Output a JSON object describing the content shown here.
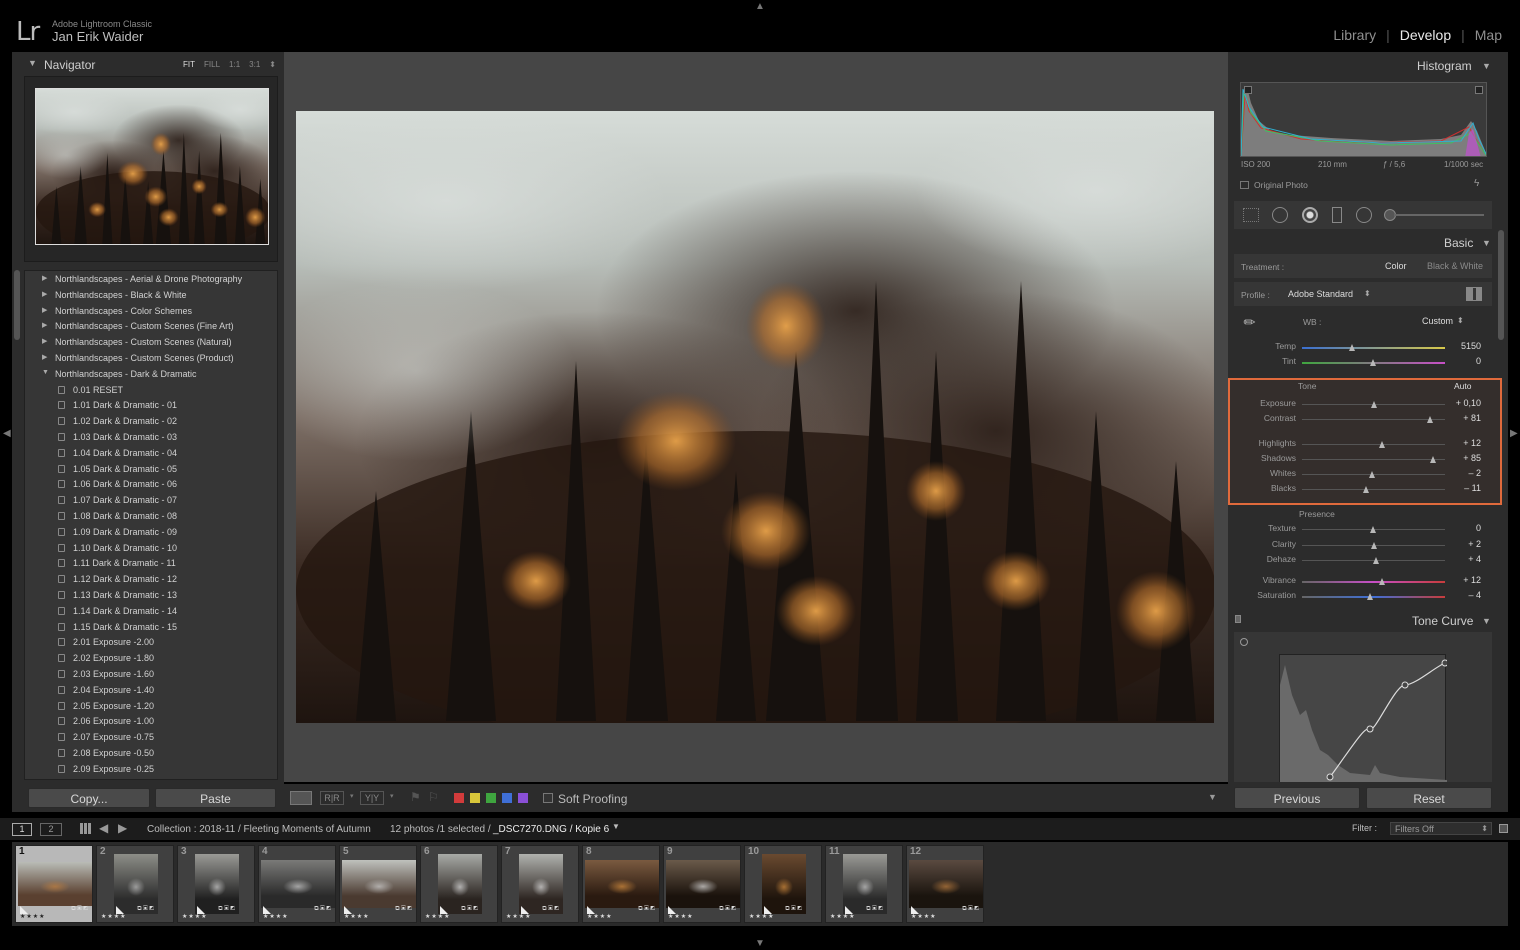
{
  "header": {
    "app_name": "Adobe Lightroom Classic",
    "user_name": "Jan Erik Waider",
    "logo": "Lr",
    "modules": [
      "Library",
      "Develop",
      "Map"
    ],
    "active_module": "Develop"
  },
  "navigator": {
    "title": "Navigator",
    "zoom_options": [
      "FIT",
      "FILL",
      "1:1",
      "3:1"
    ],
    "active_zoom": "FIT"
  },
  "presets": [
    {
      "label": "Northlandscapes - Aerial & Drone Photography",
      "type": "folder",
      "open": false
    },
    {
      "label": "Northlandscapes - Black & White",
      "type": "folder",
      "open": false
    },
    {
      "label": "Northlandscapes - Color Schemes",
      "type": "folder",
      "open": false
    },
    {
      "label": "Northlandscapes - Custom Scenes (Fine Art)",
      "type": "folder",
      "open": false
    },
    {
      "label": "Northlandscapes - Custom Scenes (Natural)",
      "type": "folder",
      "open": false
    },
    {
      "label": "Northlandscapes - Custom Scenes (Product)",
      "type": "folder",
      "open": false
    },
    {
      "label": "Northlandscapes - Dark & Dramatic",
      "type": "folder",
      "open": true
    },
    {
      "label": "0.01 RESET",
      "type": "preset"
    },
    {
      "label": "1.01 Dark & Dramatic - 01",
      "type": "preset"
    },
    {
      "label": "1.02 Dark & Dramatic - 02",
      "type": "preset"
    },
    {
      "label": "1.03 Dark & Dramatic - 03",
      "type": "preset"
    },
    {
      "label": "1.04 Dark & Dramatic - 04",
      "type": "preset"
    },
    {
      "label": "1.05 Dark & Dramatic - 05",
      "type": "preset"
    },
    {
      "label": "1.06 Dark & Dramatic - 06",
      "type": "preset"
    },
    {
      "label": "1.07 Dark & Dramatic - 07",
      "type": "preset"
    },
    {
      "label": "1.08 Dark & Dramatic - 08",
      "type": "preset"
    },
    {
      "label": "1.09 Dark & Dramatic - 09",
      "type": "preset"
    },
    {
      "label": "1.10 Dark & Dramatic - 10",
      "type": "preset"
    },
    {
      "label": "1.11 Dark & Dramatic - 11",
      "type": "preset"
    },
    {
      "label": "1.12 Dark & Dramatic - 12",
      "type": "preset"
    },
    {
      "label": "1.13 Dark & Dramatic - 13",
      "type": "preset"
    },
    {
      "label": "1.14 Dark & Dramatic - 14",
      "type": "preset"
    },
    {
      "label": "1.15 Dark & Dramatic - 15",
      "type": "preset"
    },
    {
      "label": "2.01 Exposure -2.00",
      "type": "preset"
    },
    {
      "label": "2.02 Exposure -1.80",
      "type": "preset"
    },
    {
      "label": "2.03 Exposure -1.60",
      "type": "preset"
    },
    {
      "label": "2.04 Exposure -1.40",
      "type": "preset"
    },
    {
      "label": "2.05 Exposure -1.20",
      "type": "preset"
    },
    {
      "label": "2.06 Exposure -1.00",
      "type": "preset"
    },
    {
      "label": "2.07 Exposure -0.75",
      "type": "preset"
    },
    {
      "label": "2.08 Exposure -0.50",
      "type": "preset"
    },
    {
      "label": "2.09 Exposure -0.25",
      "type": "preset"
    }
  ],
  "left_buttons": {
    "copy": "Copy...",
    "paste": "Paste"
  },
  "toolbar": {
    "soft_proofing": "Soft Proofing",
    "label_colors": [
      "#d23b3b",
      "#d8c63a",
      "#3fa53f",
      "#3f6fd6",
      "#8a4fd6"
    ]
  },
  "histogram": {
    "title": "Histogram",
    "iso": "ISO 200",
    "focal": "210 mm",
    "aperture": "ƒ / 5,6",
    "shutter": "1/1000 sec",
    "original_photo": "Original Photo"
  },
  "basic": {
    "title": "Basic",
    "treatment_label": "Treatment :",
    "treatment_color": "Color",
    "treatment_bw": "Black & White",
    "profile_label": "Profile :",
    "profile_value": "Adobe Standard",
    "wb_label": "WB :",
    "wb_value": "Custom",
    "tone_label": "Tone",
    "auto_label": "Auto",
    "presence_label": "Presence",
    "sliders": [
      {
        "label": "Temp",
        "value": "5150",
        "pos": 0.35,
        "group": "wb"
      },
      {
        "label": "Tint",
        "value": "0",
        "pos": 0.5,
        "group": "wb"
      },
      {
        "label": "Exposure",
        "value": "+ 0,10",
        "pos": 0.51,
        "group": "tone"
      },
      {
        "label": "Contrast",
        "value": "+ 81",
        "pos": 0.9,
        "group": "tone"
      },
      {
        "label": "Highlights",
        "value": "+ 12",
        "pos": 0.56,
        "group": "tone"
      },
      {
        "label": "Shadows",
        "value": "+ 85",
        "pos": 0.92,
        "group": "tone"
      },
      {
        "label": "Whites",
        "value": "– 2",
        "pos": 0.49,
        "group": "tone"
      },
      {
        "label": "Blacks",
        "value": "– 11",
        "pos": 0.45,
        "group": "tone"
      },
      {
        "label": "Texture",
        "value": "0",
        "pos": 0.5,
        "group": "presence"
      },
      {
        "label": "Clarity",
        "value": "+ 2",
        "pos": 0.51,
        "group": "presence"
      },
      {
        "label": "Dehaze",
        "value": "+ 4",
        "pos": 0.52,
        "group": "presence"
      },
      {
        "label": "Vibrance",
        "value": "+ 12",
        "pos": 0.56,
        "group": "presence"
      },
      {
        "label": "Saturation",
        "value": "– 4",
        "pos": 0.48,
        "group": "presence"
      }
    ]
  },
  "tone_curve": {
    "title": "Tone Curve"
  },
  "right_buttons": {
    "previous": "Previous",
    "reset": "Reset"
  },
  "filmstrip": {
    "page1": "1",
    "page2": "2",
    "breadcrumb": "Collection : 2018-11 / Fleeting Moments of Autumn",
    "count": "12 photos /1 selected /",
    "filename": "_DSC7270.DNG / Kopie 6",
    "filter_label": "Filter :",
    "filter_value": "Filters Off",
    "thumbs": [
      "1",
      "2",
      "3",
      "4",
      "5",
      "6",
      "7",
      "8",
      "9",
      "10",
      "11",
      "12"
    ],
    "stars": "★★★★"
  }
}
